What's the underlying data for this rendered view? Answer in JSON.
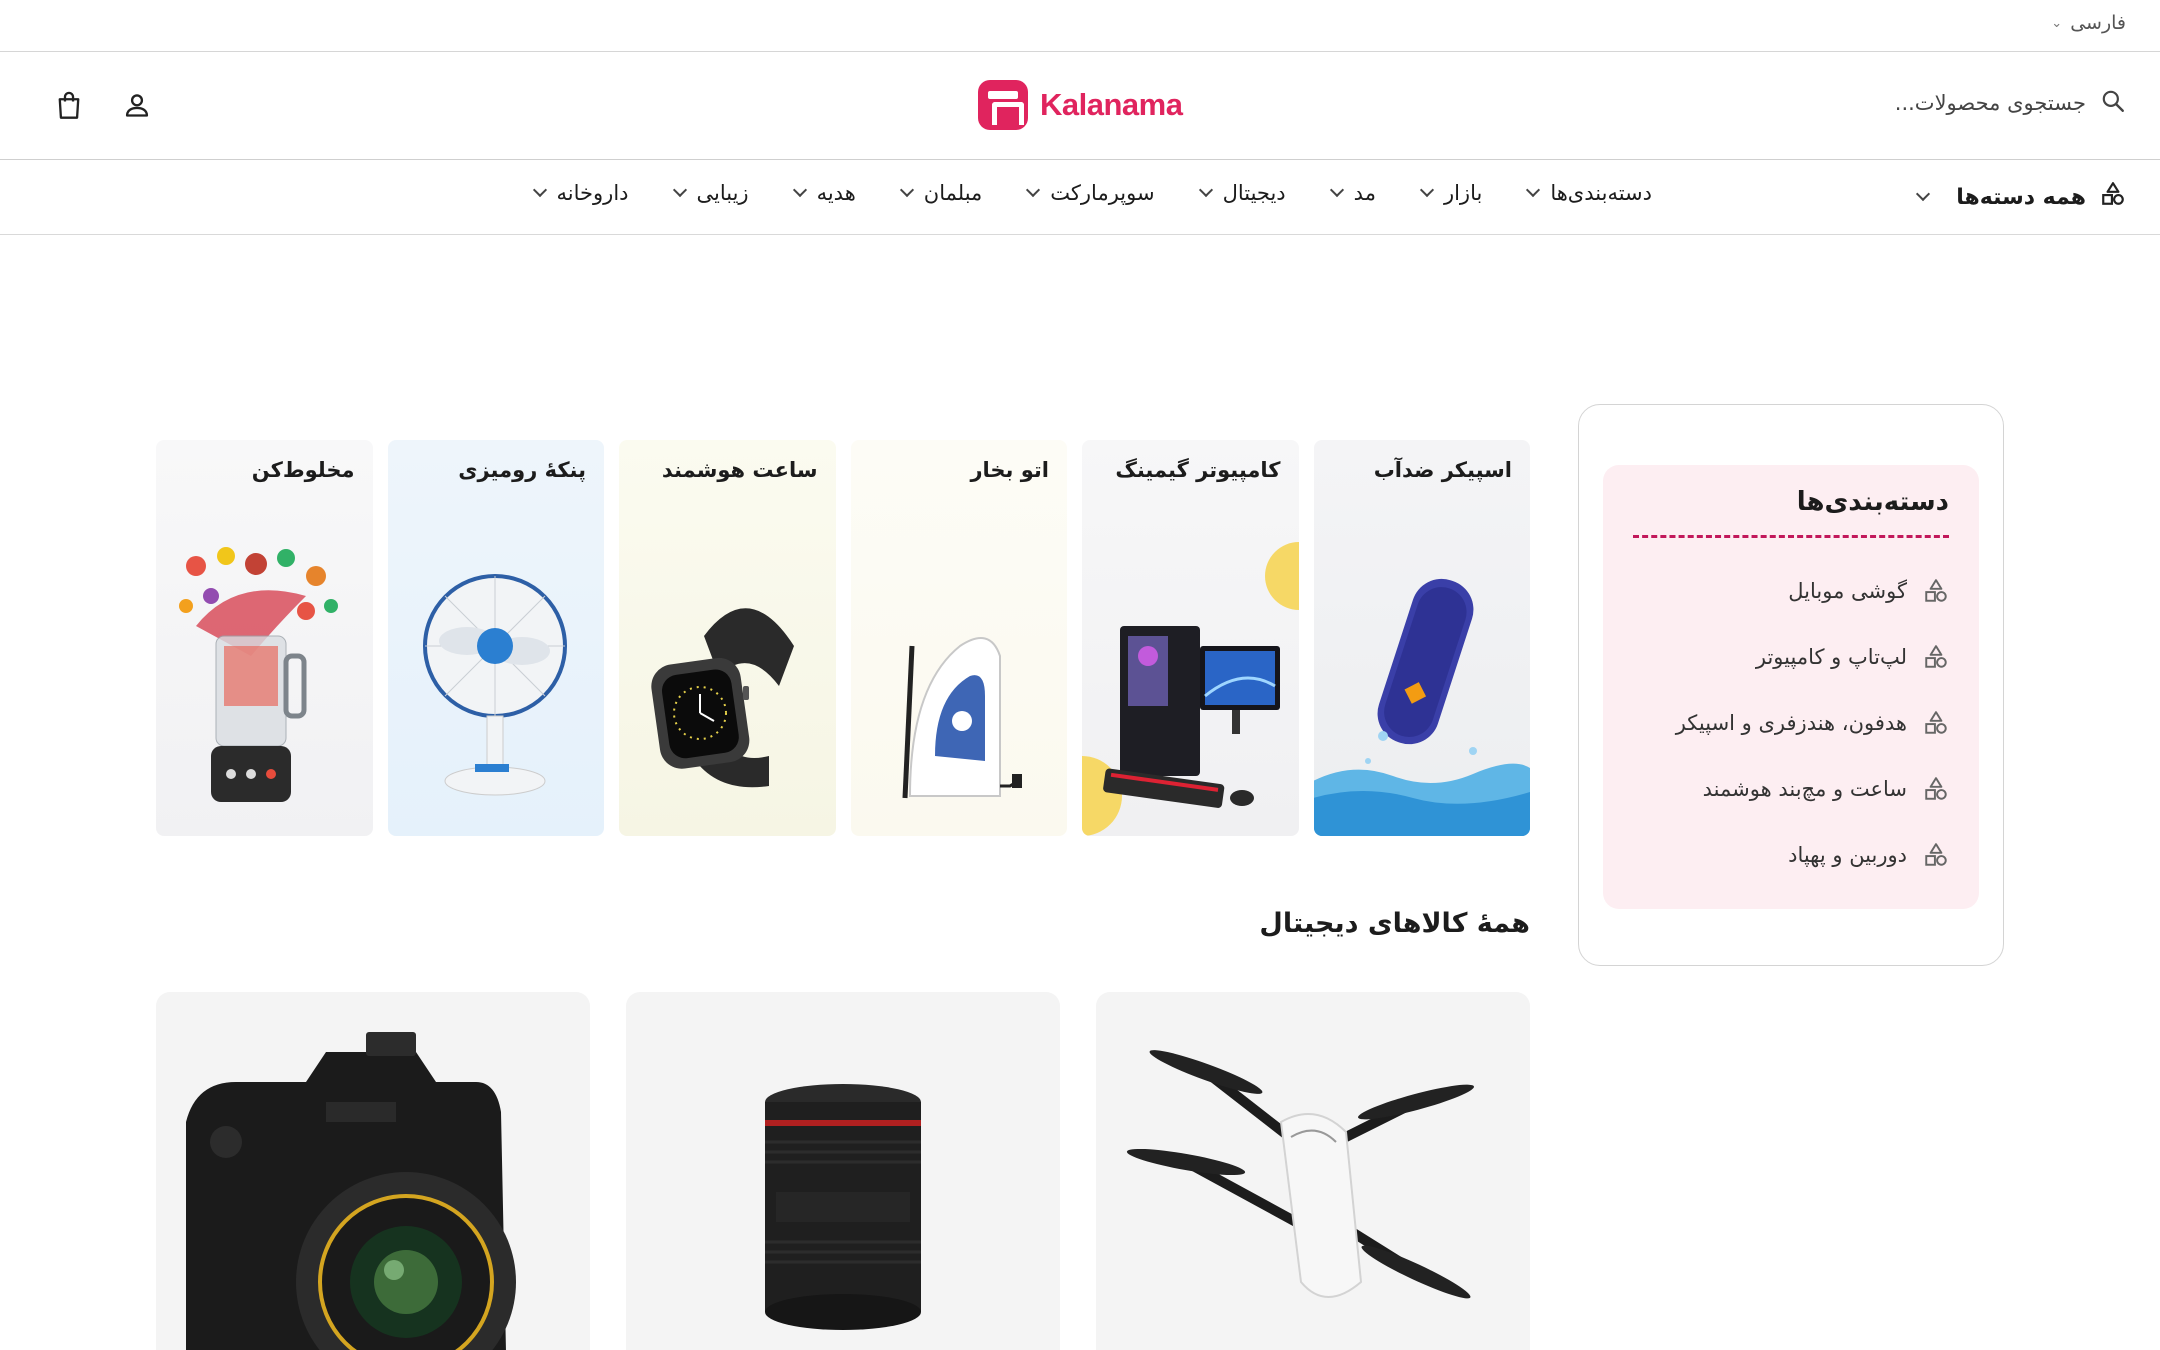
{
  "language": {
    "label": "فارسی"
  },
  "header": {
    "search_placeholder": "جستجوی محصولات...",
    "logo_text": "Kalanama",
    "brand_color": "#e0245e"
  },
  "nav": {
    "all_categories": "همه دسته‌ها",
    "items": [
      {
        "label": "دسته‌بندی‌ها"
      },
      {
        "label": "بازار"
      },
      {
        "label": "مد"
      },
      {
        "label": "دیجیتال"
      },
      {
        "label": "سوپرمارکت"
      },
      {
        "label": "مبلمان"
      },
      {
        "label": "هدیه"
      },
      {
        "label": "زیبایی"
      },
      {
        "label": "داروخانه"
      }
    ]
  },
  "sidebar": {
    "title": "دسته‌بندی‌ها",
    "items": [
      {
        "label": "گوشی موبایل",
        "icon": "shapes-icon"
      },
      {
        "label": "لپ‌تاپ و کامپیوتر",
        "icon": "shapes-icon"
      },
      {
        "label": "هدفون، هندزفری و اسپیکر",
        "icon": "shapes-icon"
      },
      {
        "label": "ساعت و مچ‌بند هوشمند",
        "icon": "shapes-icon"
      },
      {
        "label": "دوربین و پهپاد",
        "icon": "shapes-icon"
      }
    ]
  },
  "tiles": [
    {
      "label": "اسپیکر ضدآب"
    },
    {
      "label": "کامپیوتر گیمینگ"
    },
    {
      "label": "اتو بخار"
    },
    {
      "label": "ساعت هوشمند"
    },
    {
      "label": "پنکهٔ رومیزی"
    },
    {
      "label": "مخلوط‌کن"
    }
  ],
  "section": {
    "title": "همهٔ کالاهای دیجیتال"
  }
}
